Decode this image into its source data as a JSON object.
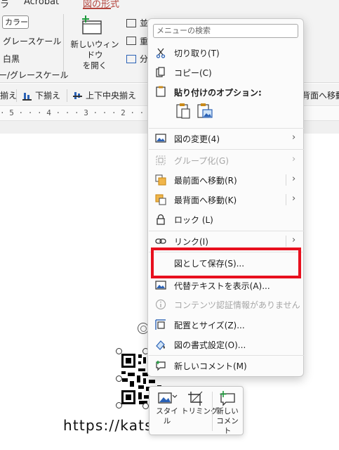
{
  "ribbon": {
    "tabs": [
      {
        "label": "ラ"
      },
      {
        "label": "Acrobat"
      },
      {
        "label": "図の形式"
      }
    ],
    "color_button": "カラー",
    "color_items": [
      "グレースケール",
      "白黒",
      "ー/グレースケール"
    ],
    "new_window": "新しいウィンドウ\nを開く",
    "right_items": [
      "並",
      "重",
      "分"
    ]
  },
  "align_bar": {
    "items": [
      "揃え",
      "下揃え",
      "上下中央揃え",
      "背面へ移動"
    ]
  },
  "ruler": {
    "marks": "· 5 · · · 4 · · · 3 · · · 2 · · · 1 · · ·"
  },
  "context_menu": {
    "search_placeholder": "メニューの検索",
    "items": [
      {
        "label": "切り取り(T)",
        "icon": "scissors-icon",
        "enabled": true,
        "submenu": false
      },
      {
        "label": "コピー(C)",
        "icon": "copy-icon",
        "enabled": true,
        "submenu": false
      },
      {
        "label": "図の変更(4)",
        "icon": "change-picture-icon",
        "enabled": true,
        "submenu": true
      },
      {
        "label": "グループ化(G)",
        "icon": "group-icon",
        "enabled": false,
        "submenu": true
      },
      {
        "label": "最前面へ移動(R)",
        "icon": "bring-front-icon",
        "enabled": true,
        "submenu": true
      },
      {
        "label": "最背面へ移動(K)",
        "icon": "send-back-icon",
        "enabled": true,
        "submenu": true
      },
      {
        "label": "ロック (L)",
        "icon": "lock-icon",
        "enabled": true,
        "submenu": false
      },
      {
        "label": "リンク(I)",
        "icon": "link-icon",
        "enabled": true,
        "submenu": true
      },
      {
        "label": "図として保存(S)...",
        "icon": "",
        "enabled": true,
        "submenu": false
      },
      {
        "label": "代替テキストを表示(A)...",
        "icon": "alt-text-icon",
        "enabled": true,
        "submenu": false
      },
      {
        "label": "コンテンツ認証情報がありません",
        "icon": "info-icon",
        "enabled": false,
        "submenu": false
      },
      {
        "label": "配置とサイズ(Z)...",
        "icon": "size-position-icon",
        "enabled": true,
        "submenu": false
      },
      {
        "label": "図の書式設定(O)...",
        "icon": "format-picture-icon",
        "enabled": true,
        "submenu": false
      },
      {
        "label": "新しいコメント(M)",
        "icon": "new-comment-icon",
        "enabled": true,
        "submenu": false
      }
    ],
    "paste_options_title": "貼り付けのオプション:",
    "highlight_color": "#e8101e"
  },
  "mini_toolbar": {
    "style_label": "スタイ\nル",
    "crop_label": "トリミング",
    "comment_label": "新しい\nコメント"
  },
  "document": {
    "url_text": "https://kats"
  }
}
